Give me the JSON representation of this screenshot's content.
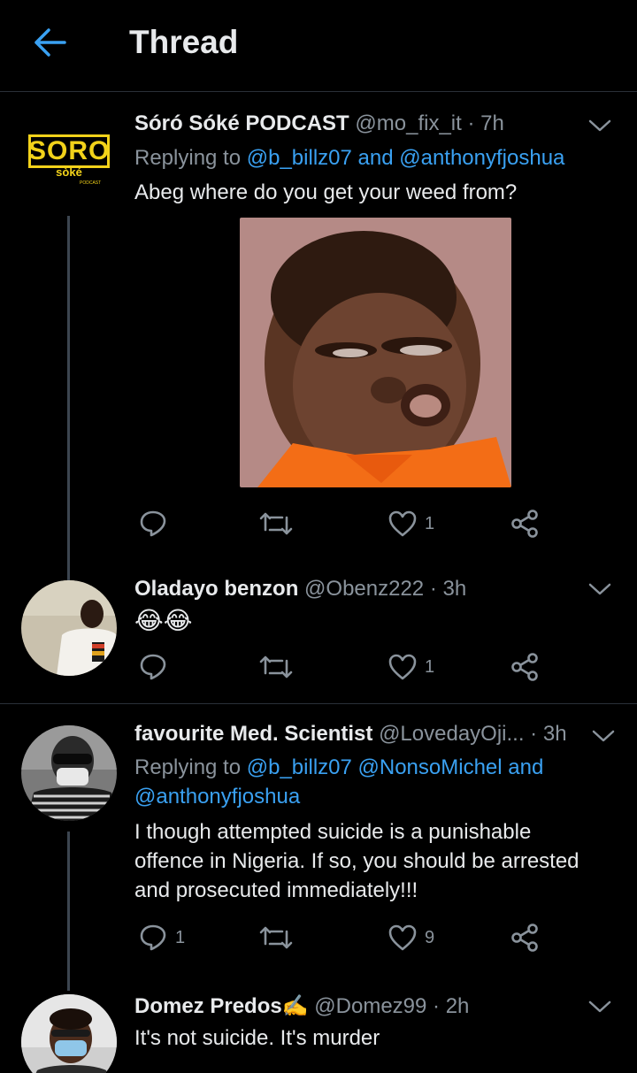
{
  "header": {
    "title": "Thread"
  },
  "tweets": [
    {
      "name": "Sóró Sóké PODCAST",
      "handle": "@mo_fix_it",
      "dot": "·",
      "time": "7h",
      "replying_prefix": "Replying to",
      "replying_mentions": "@b_billz07 and @anthonyfjoshua",
      "text": "Abeg where do you get your weed from?",
      "avatar_logo": {
        "main": "SORO",
        "sub": "sòké",
        "small": "PODCAST"
      },
      "likes": "1"
    },
    {
      "name": "Oladayo benzon",
      "handle": "@Obenz222",
      "dot": "·",
      "time": "3h",
      "text": "😂😂",
      "likes": "1"
    },
    {
      "name": "favourite Med. Scientist",
      "handle": "@LovedayOji...",
      "dot": "·",
      "time": "3h",
      "replying_prefix": "Replying to",
      "replying_mentions_1": "@b_billz07 @NonsoMichel and",
      "replying_mentions_2": "@anthonyfjoshua",
      "text_lines": [
        "I though attempted suicide is a punishable",
        "offence in Nigeria. If so, you should be arrested",
        "and prosecuted immediately!!!"
      ],
      "replies": "1",
      "likes": "9"
    },
    {
      "name": "Domez Predos",
      "name_emoji": "✍️",
      "handle": "@Domez99",
      "dot": "·",
      "time": "2h",
      "text": "It's not suicide. It's murder"
    }
  ],
  "colors": {
    "background": "#000000",
    "accent": "#3aa1f2",
    "secondary_text": "#8a939c",
    "primary_text": "#e8eaec"
  },
  "icons": [
    "back-arrow-icon",
    "chevron-down-icon",
    "reply-icon",
    "retweet-icon",
    "like-icon",
    "share-icon"
  ]
}
